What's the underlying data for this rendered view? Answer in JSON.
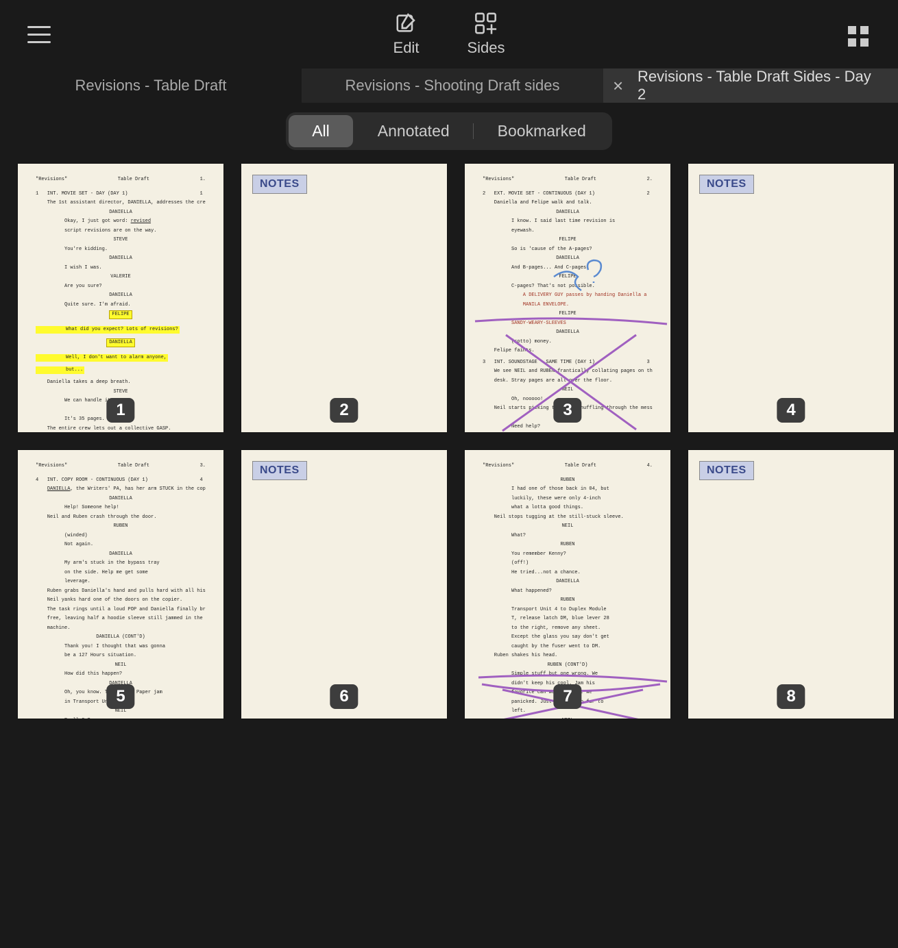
{
  "toolbar": {
    "edit_label": "Edit",
    "sides_label": "Sides"
  },
  "tabs": [
    {
      "label": "Revisions - Table Draft",
      "active": false,
      "closable": false
    },
    {
      "label": "Revisions - Shooting Draft sides",
      "active": false,
      "closable": false
    },
    {
      "label": "Revisions - Table Draft Sides - Day 2",
      "active": true,
      "closable": true
    }
  ],
  "filters": {
    "all": "All",
    "annotated": "Annotated",
    "bookmarked": "Bookmarked",
    "active": "all"
  },
  "notes_badge": "NOTES",
  "script_title": "\"Revisions\"",
  "script_draft": "Table Draft",
  "pages": [
    {
      "number": "1",
      "type": "script",
      "page_label": "1.",
      "has_highlights": true
    },
    {
      "number": "2",
      "type": "notes"
    },
    {
      "number": "3",
      "type": "script",
      "page_label": "2.",
      "has_annotations": true,
      "annotation_type": "x-question"
    },
    {
      "number": "4",
      "type": "notes"
    },
    {
      "number": "5",
      "type": "script",
      "page_label": "3."
    },
    {
      "number": "6",
      "type": "notes"
    },
    {
      "number": "7",
      "type": "script",
      "page_label": "4.",
      "has_annotations": true,
      "annotation_type": "underline-x"
    },
    {
      "number": "8",
      "type": "notes"
    }
  ]
}
